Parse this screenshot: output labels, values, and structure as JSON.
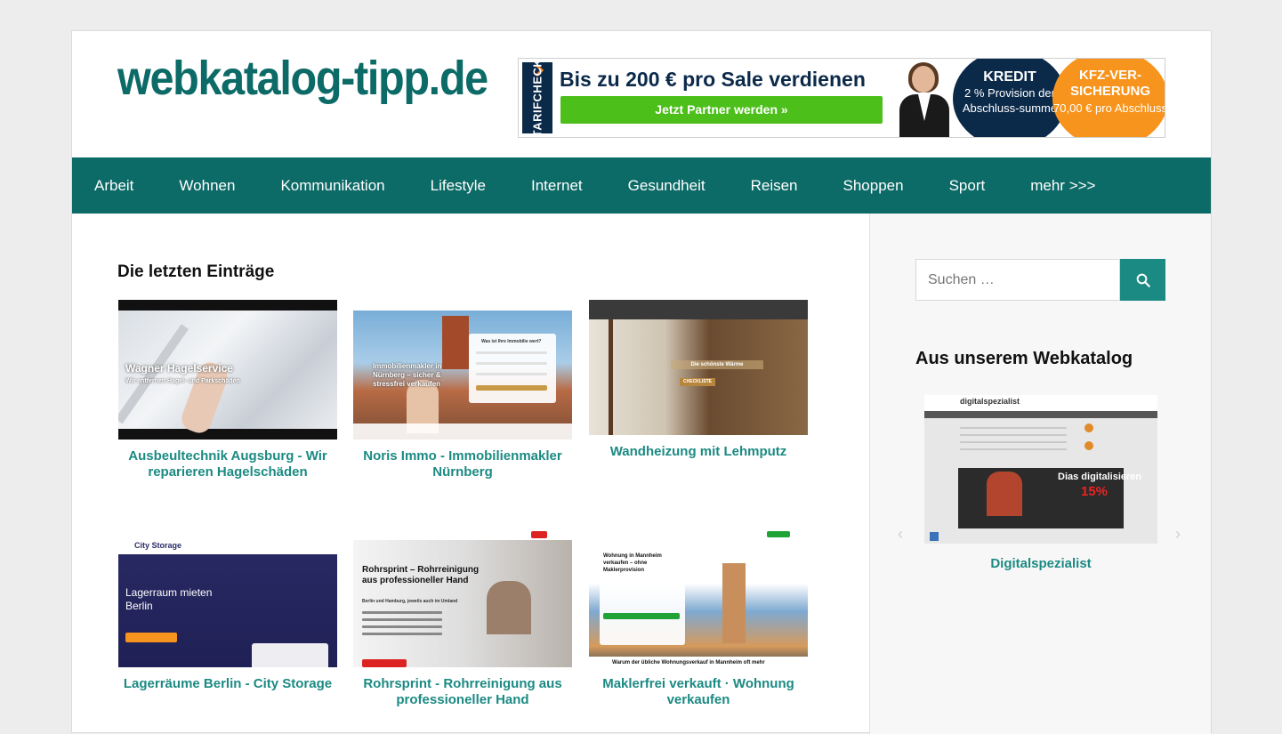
{
  "site": {
    "logo": "webkatalog-tipp.de"
  },
  "banner": {
    "brand": "TARIFCHECK",
    "headline": "Bis zu 200 € pro Sale verdienen",
    "cta": "Jetzt Partner werden »",
    "kredit_title": "KREDIT",
    "kredit_text": "2 % Provision der Abschluss-summe",
    "kfz_title": "KFZ-VER-SICHERUNG",
    "kfz_text": "70,00 € pro Abschluss",
    "colors": {
      "navy": "#0b2a4a",
      "green": "#4cbf1a",
      "orange": "#f7941d"
    }
  },
  "nav": {
    "items": [
      "Arbeit",
      "Wohnen",
      "Kommunikation",
      "Lifestyle",
      "Internet",
      "Gesundheit",
      "Reisen",
      "Shoppen",
      "Sport",
      "mehr >>>"
    ]
  },
  "main": {
    "title": "Die letzten Einträge",
    "entries": [
      {
        "caption": "Ausbeultechnik Augsburg - Wir reparieren Hagelschäden",
        "thumb_text": "Wagner Hagelservice",
        "thumb_sub": "Wir entfernen Hagel- und Parkschäden"
      },
      {
        "caption": "Noris Immo - Immobilienmakler Nürnberg",
        "thumb_text": "Immobilienmakler in Nürnberg – sicher & stressfrei verkaufen",
        "thumb_sub": "Was ist Ihre Immobilie wert?"
      },
      {
        "caption": "Wandheizung mit Lehmputz",
        "thumb_text": "Die schönste Wärme",
        "thumb_sub": "CHECKLISTE"
      },
      {
        "caption": "Lagerräume Berlin - City Storage",
        "thumb_text": "Lagerraum mieten Berlin",
        "thumb_sub": "City Storage"
      },
      {
        "caption": "Rohrsprint - Rohrreinigung aus professioneller Hand",
        "thumb_text": "Rohrsprint – Rohrreinigung aus professioneller Hand",
        "thumb_sub": "Berlin und Hamburg, jeweils auch im Umland"
      },
      {
        "caption": "Maklerfrei verkauft · Wohnung verkaufen",
        "thumb_text": "Wohnung in Mannheim verkaufen – ohne Maklerprovision",
        "thumb_sub": "Warum der übliche Wohnungsverkauf in Mannheim oft mehr"
      }
    ]
  },
  "sidebar": {
    "search_placeholder": "Suchen …",
    "title": "Aus unserem Webkatalog",
    "featured": {
      "caption": "Digitalspezialist",
      "thumb_brand": "digitalspezialist",
      "thumb_text": "Dias digitalisieren",
      "thumb_badge": "15%"
    }
  },
  "colors": {
    "primary": "#0c6a67",
    "link": "#1b8a83"
  }
}
